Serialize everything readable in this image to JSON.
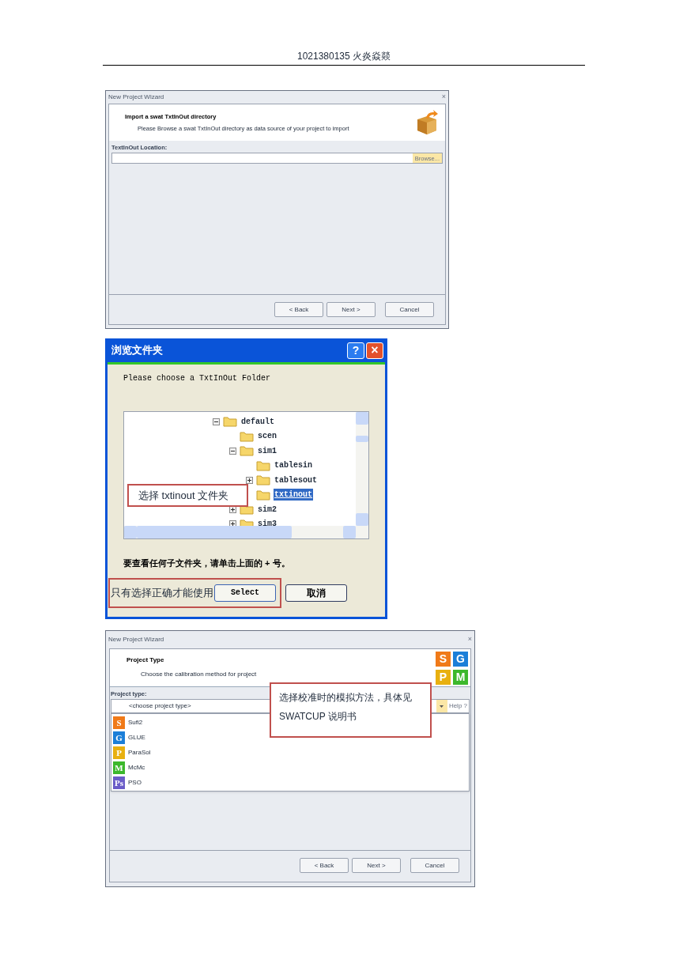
{
  "page_header": "1021380135  火炎焱燚",
  "wizard_import": {
    "title": "New Project Wizard",
    "close": "×",
    "heading": "Import a swat TxtInOut directory",
    "subheading": "Please Browse a swat TxtInOut directory as data source of your project to import",
    "field_label": "TextInOut Location:",
    "browse": "Browse...",
    "buttons": [
      "< Back",
      "Next >",
      "Cancel"
    ]
  },
  "browse_dialog": {
    "title": "浏览文件夹",
    "help": "?",
    "close": "×",
    "prompt": "Please choose a TxtInOut Folder",
    "tree": [
      {
        "label": "default",
        "expanded": true,
        "selected": false,
        "children": [
          {
            "label": "scen",
            "selected": false
          },
          {
            "label": "sim1",
            "expanded": true,
            "selected": false,
            "children": [
              {
                "label": "tablesin",
                "selected": false
              },
              {
                "label": "tablesout",
                "expanded": false,
                "selected": false
              },
              {
                "label": "txtinout",
                "selected": true
              }
            ]
          },
          {
            "label": "sim2",
            "expanded": false,
            "selected": false
          },
          {
            "label": "sim3",
            "expanded": false,
            "selected": false
          }
        ]
      }
    ],
    "hint": "要查看任何子文件夹，请单击上面的 + 号。",
    "select": "Select",
    "cancel": "取消",
    "tree_note": "选择 txtinout 文件夹",
    "button_note": "只有选择正确才能使用"
  },
  "wizard_type": {
    "title": "New Project Wizard",
    "close": "×",
    "heading": "Project Type",
    "subheading": "Choose the calibration method for project",
    "header_badges": [
      {
        "letter": "S",
        "color": "#f07a18"
      },
      {
        "letter": "G",
        "color": "#1c7fd8"
      },
      {
        "letter": "P",
        "color": "#e8b010"
      },
      {
        "letter": "M",
        "color": "#3cb82c"
      }
    ],
    "field_label": "Project type:",
    "dropdown": "<choose project type>",
    "help": "Help ?",
    "options": [
      {
        "letter": "S",
        "color": "#f07a18",
        "label": "Sufi2"
      },
      {
        "letter": "G",
        "color": "#1c7fd8",
        "label": "GLUE"
      },
      {
        "letter": "P",
        "color": "#e8b010",
        "label": "ParaSol"
      },
      {
        "letter": "M",
        "color": "#3cb82c",
        "label": "McMc"
      },
      {
        "letter": "Ps",
        "color": "#6a5cc8",
        "label": "PSO"
      }
    ],
    "note": "选择校准时的模拟方法，具体见SWATCUP 说明书",
    "buttons": [
      "< Back",
      "Next >",
      "Cancel"
    ]
  }
}
